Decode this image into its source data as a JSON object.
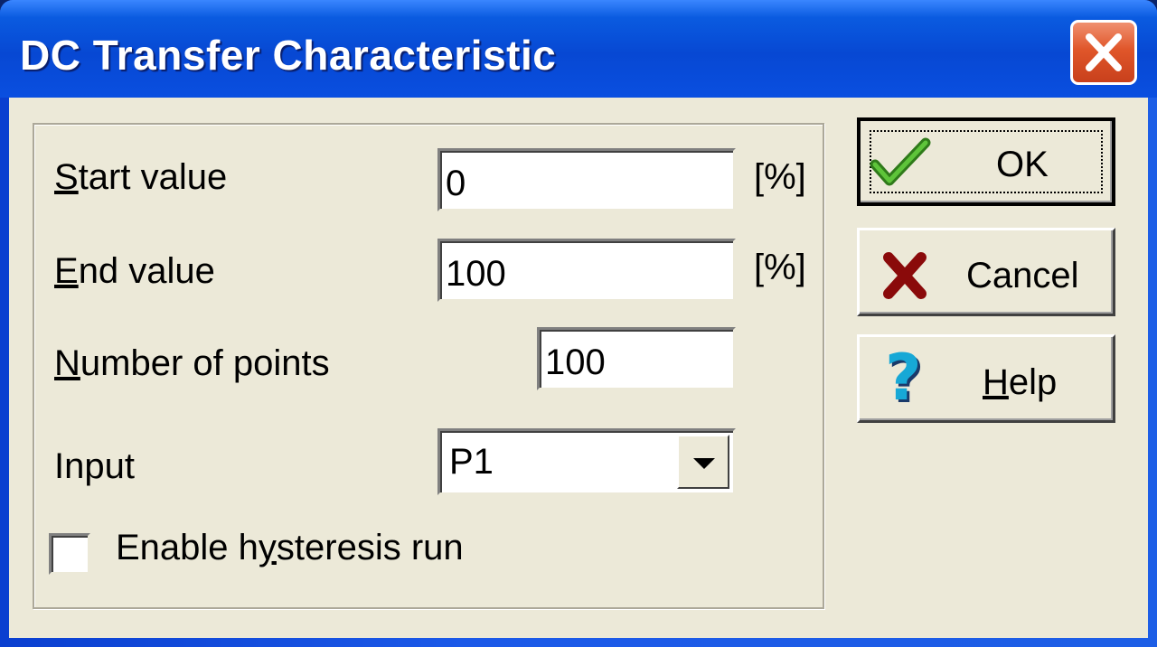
{
  "window": {
    "title": "DC Transfer Characteristic"
  },
  "form": {
    "start_value": {
      "label_first": "S",
      "label_rest": "tart value",
      "value": "0",
      "unit": "[%]"
    },
    "end_value": {
      "label_first": "E",
      "label_rest": "nd value",
      "value": "100",
      "unit": "[%]"
    },
    "number_of_points": {
      "label_first": "N",
      "label_rest": "umber of points",
      "value": "100"
    },
    "input": {
      "label": "Input",
      "selected": "P1"
    },
    "hysteresis": {
      "label_before": "Enable h",
      "label_underlined": "y",
      "label_after": "steresis run",
      "checked": false
    }
  },
  "buttons": {
    "ok": {
      "label": "OK",
      "icon": "checkmark-icon"
    },
    "cancel": {
      "label": "Cancel",
      "icon": "x-icon"
    },
    "help": {
      "label_first": "H",
      "label_rest": "elp",
      "icon": "question-icon"
    }
  },
  "colors": {
    "titlebar": "#0748d3",
    "face": "#ece9d8",
    "close": "#e0562a"
  }
}
